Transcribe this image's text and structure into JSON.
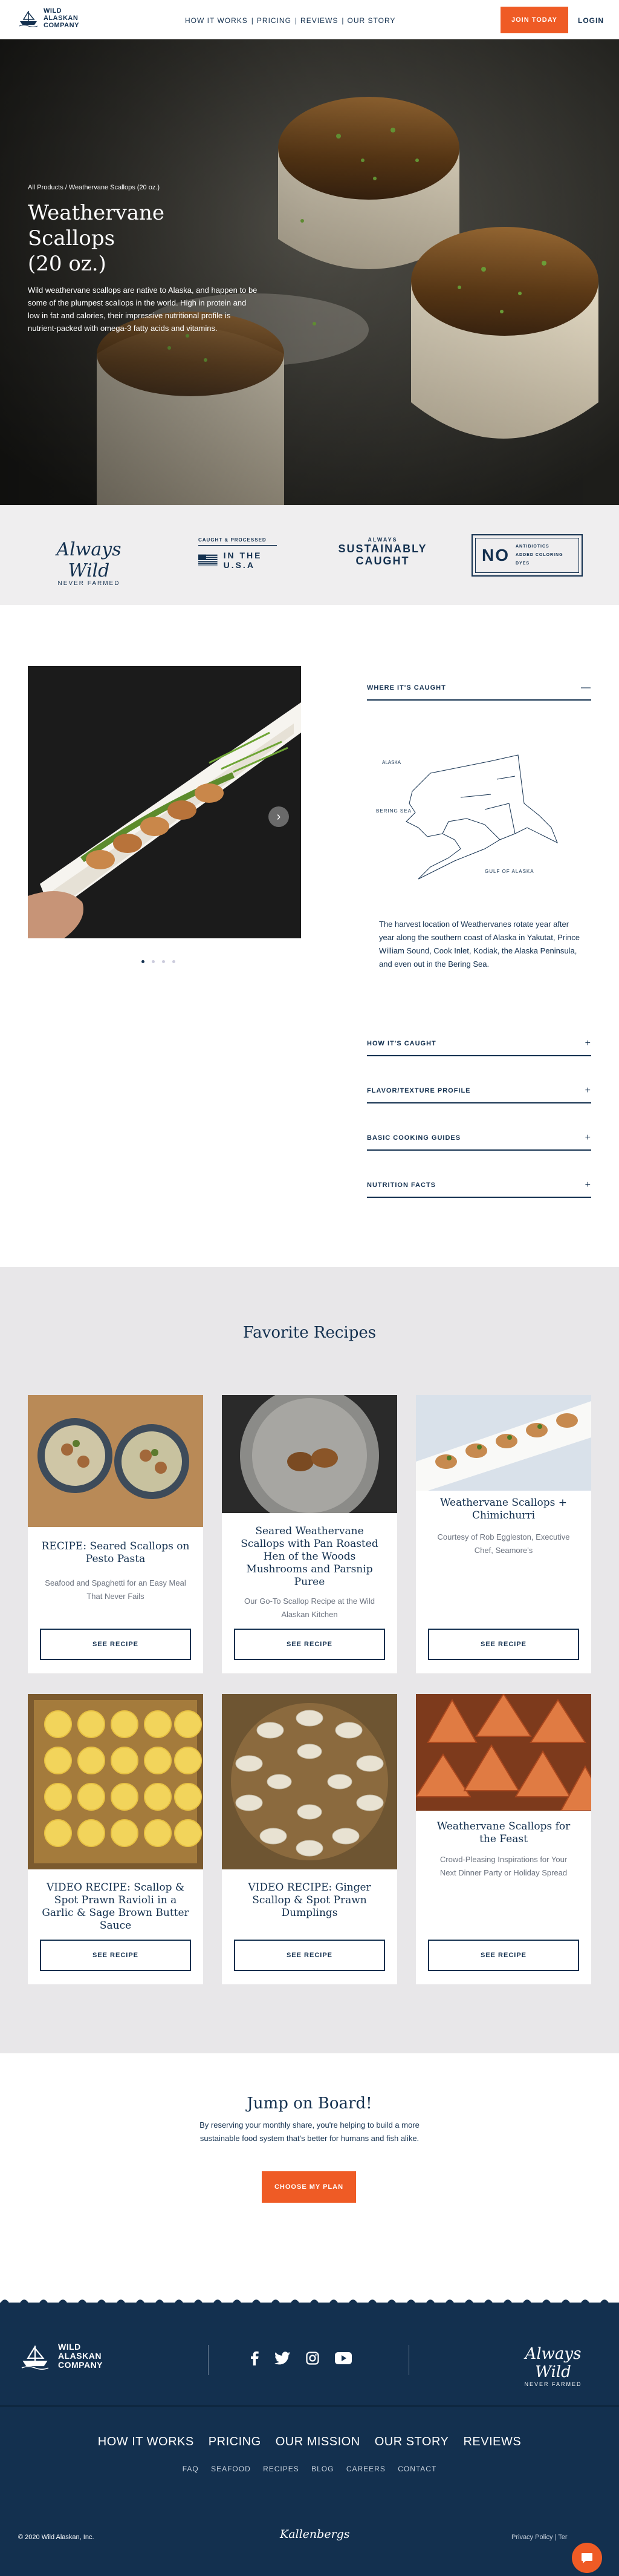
{
  "nav": {
    "logo": [
      "WILD",
      "ALASKAN",
      "COMPANY"
    ],
    "links": [
      "HOW IT WORKS",
      "PRICING",
      "REVIEWS",
      "OUR STORY"
    ],
    "join": "JOIN TODAY",
    "login": "LOGIN"
  },
  "hero": {
    "breadcrumb": "All Products / Weathervane Scallops (20 oz.)",
    "title_line1": "Weathervane Scallops",
    "title_line2": "(20 oz.)",
    "description": "Wild weathervane scallops are native to Alaska, and happen to be some of the plumpest scallops in the world. High in protein and low in fat and calories, their impressive nutritional profile is nutrient-packed with omega-3 fatty acids and vitamins."
  },
  "badges": {
    "always_wild": "Always Wild",
    "never_farmed": "NEVER FARMED",
    "caught_processed": "CAUGHT & PROCESSED",
    "in_the_usa": "IN THE U.S.A",
    "always": "ALWAYS",
    "sustainably": "SUSTAINABLY",
    "caught": "CAUGHT",
    "no": "NO",
    "no_text": [
      "ANTIBIOTICS",
      "ADDED COLORING",
      "DYES"
    ]
  },
  "product": {
    "accordion_open": {
      "title": "WHERE IT'S CAUGHT",
      "sign": "—"
    },
    "map_labels": {
      "alaska": "ALASKA",
      "bering": "BERING SEA",
      "gulf": "GULF OF ALASKA"
    },
    "body": "The harvest location of Weathervanes rotate year after year along the southern coast of Alaska in Yakutat, Prince William Sound, Cook Inlet, Kodiak, the Alaska Peninsula, and even out in the Bering Sea.",
    "accordion_closed": [
      {
        "title": "HOW IT'S CAUGHT",
        "sign": "+"
      },
      {
        "title": "FLAVOR/TEXTURE PROFILE",
        "sign": "+"
      },
      {
        "title": "BASIC COOKING GUIDES",
        "sign": "+"
      },
      {
        "title": "NUTRITION FACTS",
        "sign": "+"
      }
    ],
    "carousel_arrow": "›"
  },
  "recipes": {
    "heading": "Favorite Recipes",
    "see_label": "SEE RECIPE",
    "cards": [
      {
        "title": "RECIPE: Seared Scallops on Pesto Pasta",
        "text": "Seafood and Spaghetti for an Easy Meal That Never Fails"
      },
      {
        "title": "Seared Weathervane Scallops with Pan Roasted Hen of the Woods Mushrooms and Parsnip Puree",
        "text": "Our Go-To Scallop Recipe at the Wild Alaskan Kitchen"
      },
      {
        "title": "Weathervane Scallops + Chimichurri",
        "text": "Courtesy of Rob Eggleston, Executive Chef, Seamore's"
      },
      {
        "title": "VIDEO RECIPE: Scallop & Spot Prawn Ravioli in a Garlic & Sage Brown Butter Sauce",
        "text": ""
      },
      {
        "title": "VIDEO RECIPE: Ginger Scallop & Spot Prawn Dumplings",
        "text": ""
      },
      {
        "title": "Weathervane Scallops for the Feast",
        "text": "Crowd-Pleasing Inspirations for Your Next Dinner Party or Holiday Spread"
      }
    ]
  },
  "jump": {
    "heading": "Jump on Board!",
    "text": "By reserving your monthly share, you're helping to build a more sustainable food system that's better for humans and fish alike.",
    "cta": "CHOOSE MY PLAN"
  },
  "footer": {
    "logo": [
      "WILD",
      "ALASKAN",
      "COMPANY"
    ],
    "always_wild": "Always Wild",
    "never_farmed": "NEVER FARMED",
    "main_links": [
      "HOW IT WORKS",
      "PRICING",
      "OUR MISSION",
      "OUR STORY",
      "REVIEWS"
    ],
    "sub_links": [
      "FAQ",
      "SEAFOOD",
      "RECIPES",
      "BLOG",
      "CAREERS",
      "CONTACT"
    ],
    "copyright": "© 2020 Wild Alaskan, Inc.",
    "kallenbergs": "Kallenbergs",
    "legal": "Privacy Policy | Ter"
  }
}
